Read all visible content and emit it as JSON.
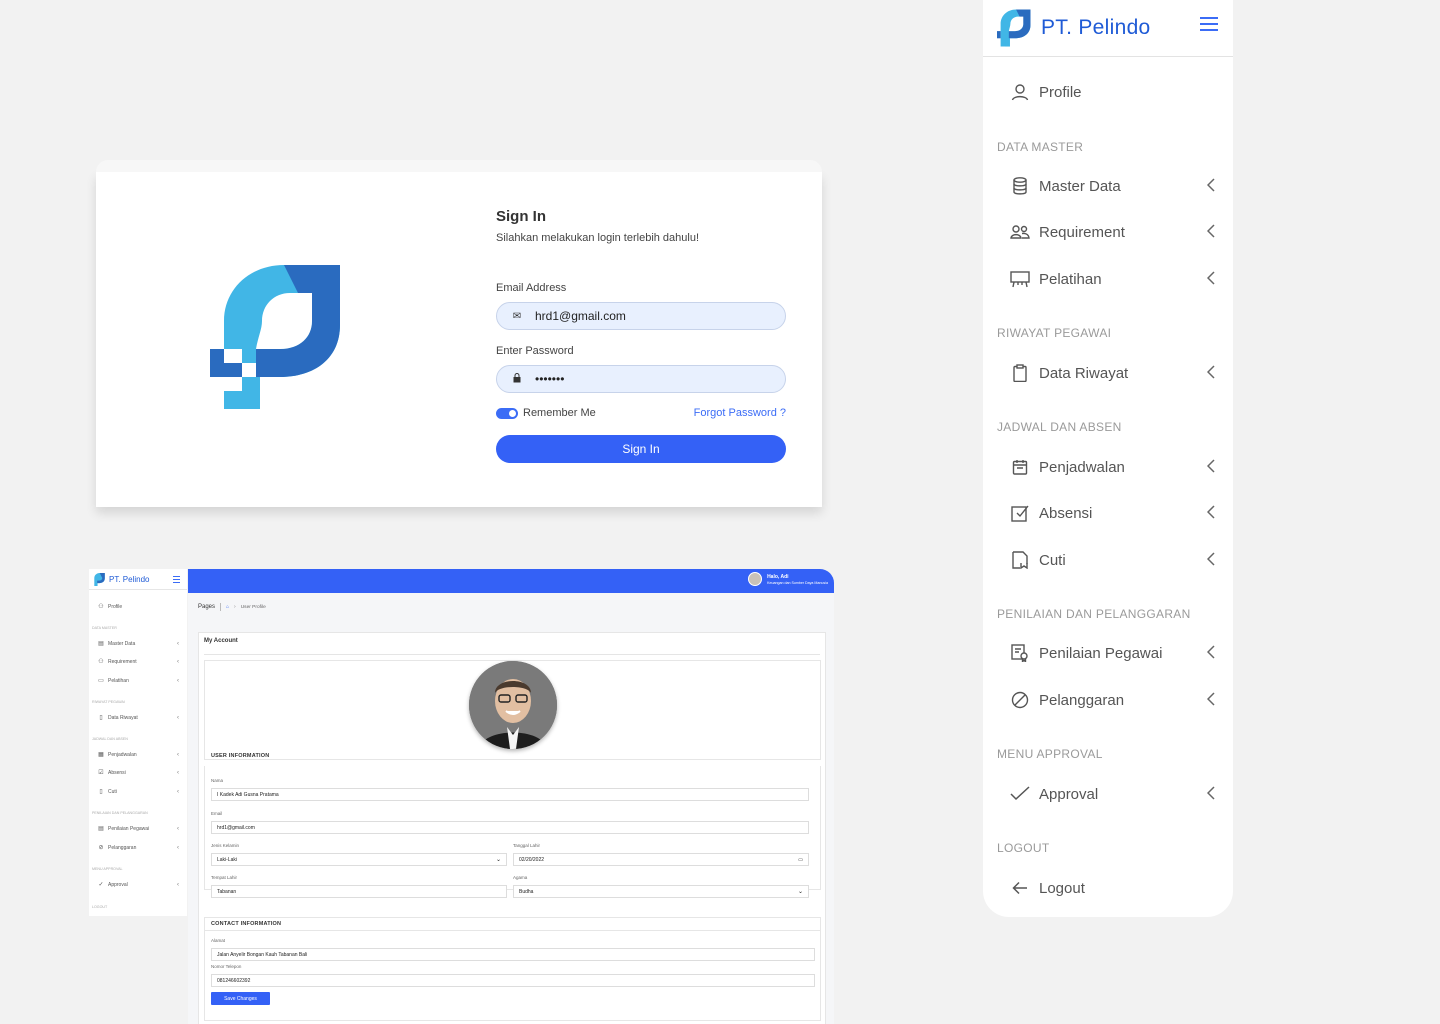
{
  "login": {
    "title": "Sign In",
    "subtitle": "Silahkan melakukan login terlebih dahulu!",
    "email_label": "Email Address",
    "email_value": "hrd1@gmail.com",
    "password_label": "Enter Password",
    "password_value": "•••••••",
    "remember_label": "Remember Me",
    "forgot_label": "Forgot Password ?",
    "signin_button": "Sign In"
  },
  "sidebar": {
    "brand": "PT. Pelindo",
    "profile": "Profile",
    "sections": [
      "DATA MASTER",
      "RIWAYAT PEGAWAI",
      "JADWAL DAN ABSEN",
      "PENILAIAN DAN PELANGGARAN",
      "MENU APPROVAL",
      "LOGOUT"
    ],
    "items": [
      {
        "label": "Master Data",
        "icon": "database-icon"
      },
      {
        "label": "Requirement",
        "icon": "users-icon"
      },
      {
        "label": "Pelatihan",
        "icon": "presentation-icon"
      },
      {
        "label": "Data Riwayat",
        "icon": "clipboard-icon"
      },
      {
        "label": "Penjadwalan",
        "icon": "calendar-icon"
      },
      {
        "label": "Absensi",
        "icon": "checkbox-icon"
      },
      {
        "label": "Cuti",
        "icon": "document-icon"
      },
      {
        "label": "Penilaian Pegawai",
        "icon": "certificate-icon"
      },
      {
        "label": "Pelanggaran",
        "icon": "ban-icon"
      },
      {
        "label": "Approval",
        "icon": "check-icon"
      }
    ],
    "logout": "Logout"
  },
  "mini": {
    "brand": "PT. Pelindo",
    "greeting": "Halo, Adi",
    "role": "Keuangan dan Sumber Daya Manusia",
    "breadcrumb_root": "Pages",
    "breadcrumb_current": "User Profile",
    "account_title": "My Account",
    "user_info_title": "USER INFORMATION",
    "nama_label": "Nama",
    "nama_value": "I Kadek Adi Gusna Pratama",
    "email_label": "Email",
    "email_value": "hrd1@gmail.com",
    "gender_label": "Jenis Kelamin",
    "gender_value": "Laki-Laki",
    "dob_label": "Tanggal Lahir",
    "dob_value": "02/20/2022",
    "pob_label": "Tempat Lahir",
    "pob_value": "Tabanan",
    "religion_label": "Agama",
    "religion_value": "Budha",
    "contact_title": "CONTACT INFORMATION",
    "address_label": "Alamat",
    "address_value": "Jalan Anyelir Bongan Kauh Tabanan Bali",
    "phone_label": "Nomor Telepon",
    "phone_value": "081246602392",
    "save_button": "Save Changes"
  },
  "colors": {
    "primary": "#3461f6",
    "brand_dark": "#1f5bd6",
    "logo_light": "#41b6e6",
    "logo_dark": "#2a6bbf"
  }
}
